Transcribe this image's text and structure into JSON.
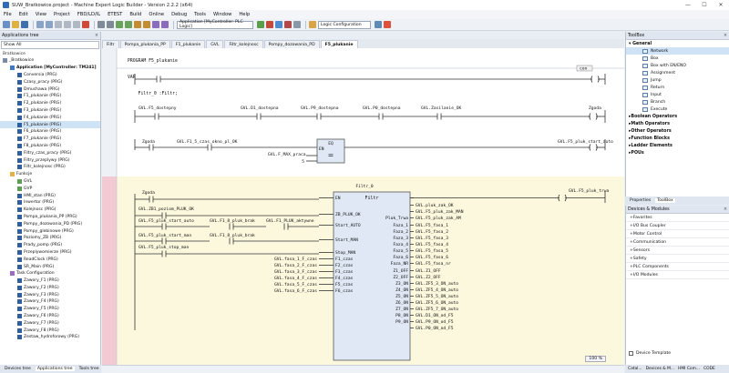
{
  "window": {
    "title": "SUW_Bratkowice.project - Machine Expert Logic Builder - Version 2.2.2 (x64)",
    "controls": [
      "—",
      "☐",
      "✕"
    ]
  },
  "menu": [
    "File",
    "Edit",
    "View",
    "Project",
    "FBD/LD/IL",
    "ETEST",
    "Build",
    "Online",
    "Debug",
    "Tools",
    "Window",
    "Help"
  ],
  "toolbar": {
    "app_combo": "Application [MyController: PLC Logic]",
    "config_combo": "Logic Configuration"
  },
  "app_tree": {
    "title": "Applications tree",
    "filter": "Show All",
    "header": "Bratkowice",
    "items": [
      {
        "label": "_Bratkowice",
        "level": 0,
        "kind": "root"
      },
      {
        "label": "Application [MyController: TM241]",
        "level": 1,
        "kind": "app",
        "bold": true
      },
      {
        "label": "Conversia (PRG)",
        "level": 2,
        "kind": "prg"
      },
      {
        "label": "Czasy_pracy (PRG)",
        "level": 2,
        "kind": "prg"
      },
      {
        "label": "Dmuchawa (PRG)",
        "level": 2,
        "kind": "prg"
      },
      {
        "label": "F1_plukanie (PRG)",
        "level": 2,
        "kind": "prg"
      },
      {
        "label": "F2_plukanie (PRG)",
        "level": 2,
        "kind": "prg"
      },
      {
        "label": "F3_plukanie (PRG)",
        "level": 2,
        "kind": "prg"
      },
      {
        "label": "F4_plukanie (PRG)",
        "level": 2,
        "kind": "prg"
      },
      {
        "label": "F5_plukanie (PRG)",
        "level": 2,
        "kind": "prg",
        "selected": true
      },
      {
        "label": "F6_plukanie (PRG)",
        "level": 2,
        "kind": "prg"
      },
      {
        "label": "F7_plukanie (PRG)",
        "level": 2,
        "kind": "prg"
      },
      {
        "label": "F8_plukanie (PRG)",
        "level": 2,
        "kind": "prg"
      },
      {
        "label": "Filtry_czas_pracy (PRG)",
        "level": 2,
        "kind": "prg"
      },
      {
        "label": "Filtry_przeplywy (PRG)",
        "level": 2,
        "kind": "prg"
      },
      {
        "label": "Filtr_kolejnosc (PRG)",
        "level": 2,
        "kind": "prg"
      },
      {
        "label": "Funkcje",
        "level": 1,
        "kind": "folder"
      },
      {
        "label": "GVL",
        "level": 2,
        "kind": "gvl"
      },
      {
        "label": "GVP",
        "level": 2,
        "kind": "gvl"
      },
      {
        "label": "HMI_stan (PRG)",
        "level": 2,
        "kind": "prg"
      },
      {
        "label": "Inwertor (PRG)",
        "level": 2,
        "kind": "prg"
      },
      {
        "label": "Kolejnosc (PRG)",
        "level": 2,
        "kind": "prg"
      },
      {
        "label": "Pompa_plukania_PP (PRG)",
        "level": 2,
        "kind": "prg"
      },
      {
        "label": "Pompy_dozowania_PD (PRG)",
        "level": 2,
        "kind": "prg"
      },
      {
        "label": "Pompy_glebinowe (PRG)",
        "level": 2,
        "kind": "prg"
      },
      {
        "label": "Poziomy_ZB (PRG)",
        "level": 2,
        "kind": "prg"
      },
      {
        "label": "Prady_pomp (PRG)",
        "level": 2,
        "kind": "prg"
      },
      {
        "label": "Przeplywomierze (PRG)",
        "level": 2,
        "kind": "prg"
      },
      {
        "label": "ReadClock (PRG)",
        "level": 2,
        "kind": "prg"
      },
      {
        "label": "SR_Main (PRG)",
        "level": 2,
        "kind": "prg"
      },
      {
        "label": "Task Configuration",
        "level": 1,
        "kind": "task"
      },
      {
        "label": "Zawory_F1 (PRG)",
        "level": 2,
        "kind": "prg"
      },
      {
        "label": "Zawory_F2 (PRG)",
        "level": 2,
        "kind": "prg"
      },
      {
        "label": "Zawory_F3 (PRG)",
        "level": 2,
        "kind": "prg"
      },
      {
        "label": "Zawory_F4 (PRG)",
        "level": 2,
        "kind": "prg"
      },
      {
        "label": "Zawory_F5 (PRG)",
        "level": 2,
        "kind": "prg"
      },
      {
        "label": "Zawory_F6 (PRG)",
        "level": 2,
        "kind": "prg"
      },
      {
        "label": "Zawory_F7 (PRG)",
        "level": 2,
        "kind": "prg"
      },
      {
        "label": "Zawory_F8 (PRG)",
        "level": 2,
        "kind": "prg"
      },
      {
        "label": "Zestaw_hydroforowy (PRG)",
        "level": 2,
        "kind": "prg"
      }
    ],
    "bottom_tabs": [
      "Devices tree",
      "Applications tree",
      "Tools tree"
    ]
  },
  "editor_tabs": [
    "Filtr",
    "Pompa_plukania_PP",
    "F1_plukanie",
    "GVL",
    "Filtr_kolejnosc",
    "Pompy_dozowania_PD",
    "F5_plukanie"
  ],
  "decl": {
    "lines": [
      "PROGRAM F5_plukanie",
      "VAR",
      "    Filtr_0 :Filtr;"
    ]
  },
  "ladder": {
    "net1_label": "con",
    "r2_contacts": [
      "GVL.F5_dostepny",
      "GVL.D1_dostepna",
      "GVL.P9_dostepna",
      "GVL.P0_dostepna",
      "GVL.Zasilanie_OK"
    ],
    "r2_coil": "Zgoda",
    "r3_contacts": [
      "Zgoda",
      "GVL.F1_5_czas_okno_pl_OK"
    ],
    "r3_eq_label": "EQ",
    "r3_eq_in": "EN",
    "r3_eq_var": "GVL.F_MAX_praca",
    "r3_eq_const": "5",
    "r3_coil": "GVL.F5_pluk_start_auto",
    "fb_instance": "Filtr_0",
    "fb_type": "Filtr",
    "fb_inputs": [
      "EN",
      "ZB_PLUK_OK",
      "Start_AUTO",
      "Start_MAN",
      "Stop_MAN",
      "F1_czas",
      "F2_czas",
      "F3_czas",
      "F4_czas",
      "F5_czas",
      "F6_czas"
    ],
    "fb_outputs": [
      "Pluk_Trwa",
      "Faza_1",
      "Faza_2",
      "Faza_3",
      "Faza_4",
      "Faza_5",
      "Faza_6",
      "Faza_NR",
      "Z1_OFF",
      "Z2_OFF",
      "Z3_ON",
      "Z4_ON",
      "Z5_ON",
      "Z6_ON",
      "Z7_ON",
      "P8_ON",
      "P9_ON"
    ],
    "fb_left_contacts": [
      "Zgoda",
      "GVL.ZB1_poziom_PLUK_OK",
      "GVL.F5_pluk_start_auto",
      "GVL.F1_8_pluk_brak",
      "GVL.F1_PLUK_aktywne",
      "GVL.F5_pluk_start_man",
      "GVL.F1_8_pluk_brak",
      "GVL.F5_pluk_stop_man"
    ],
    "fb_czas_inputs": [
      "GVL.fasa_1_F_czas",
      "GVL.fasa_2_F_czas",
      "GVL.fasa_3_F_czas",
      "GVL.fasa_4_F_czas",
      "GVL.fasa_5_F_czas",
      "GVL.fasa_6_F_czas"
    ],
    "fb_right_vars": [
      "GVL.F5_pluk_trwa",
      "GVL.pluk_zak_OK",
      "GVL.F5_pluk_zak_MAN",
      "GVL.F5_pluk_zak_AM",
      "GVL.F5_fasa_1",
      "GVL.F5_fasa_2",
      "GVL.F5_fasa_3",
      "GVL.F5_fasa_4",
      "GVL.F5_fasa_5",
      "GVL.F5_fasa_6",
      "GVL.F5_fasa_nr",
      "GVL.Z1_OFF",
      "GVL.Z2_OFF",
      "GVL.ZF5_3_ON_auto",
      "GVL.ZF5_4_ON_auto",
      "GVL.ZF5_5_ON_auto",
      "GVL.ZF5_6_ON_auto",
      "GVL.ZF5_7_ON_auto",
      "GVL.D1_ON_od_F5",
      "GVL.P9_ON_od_F5",
      "GVL.P0_ON_od_F5"
    ],
    "fb_right_coil": "GVL.F5_pluk_trwa"
  },
  "zoom": "100 %",
  "toolbox": {
    "title": "ToolBox",
    "general": "General",
    "items": [
      "Network",
      "Box",
      "Box with EN/ENO",
      "Assignment",
      "Jump",
      "Return",
      "Input",
      "Branch",
      "Execute"
    ],
    "categories": [
      "Boolean Operators",
      "Math Operators",
      "Other Operators",
      "Function Blocks",
      "Ladder Elements",
      "POUs"
    ]
  },
  "right_tabs1": [
    "Properties",
    "ToolBox"
  ],
  "devices": {
    "title": "Devices & Modules",
    "items": [
      "Favorites",
      "I/O Bus Coupler",
      "Motor Control",
      "Communication",
      "Sensors",
      "Safety",
      "PLC Components",
      "I/O Modules"
    ],
    "template_label": "Device Template"
  },
  "right_tabs2": [
    "Catal...",
    "Devices & M...",
    "HMI Com...",
    "CODE"
  ]
}
